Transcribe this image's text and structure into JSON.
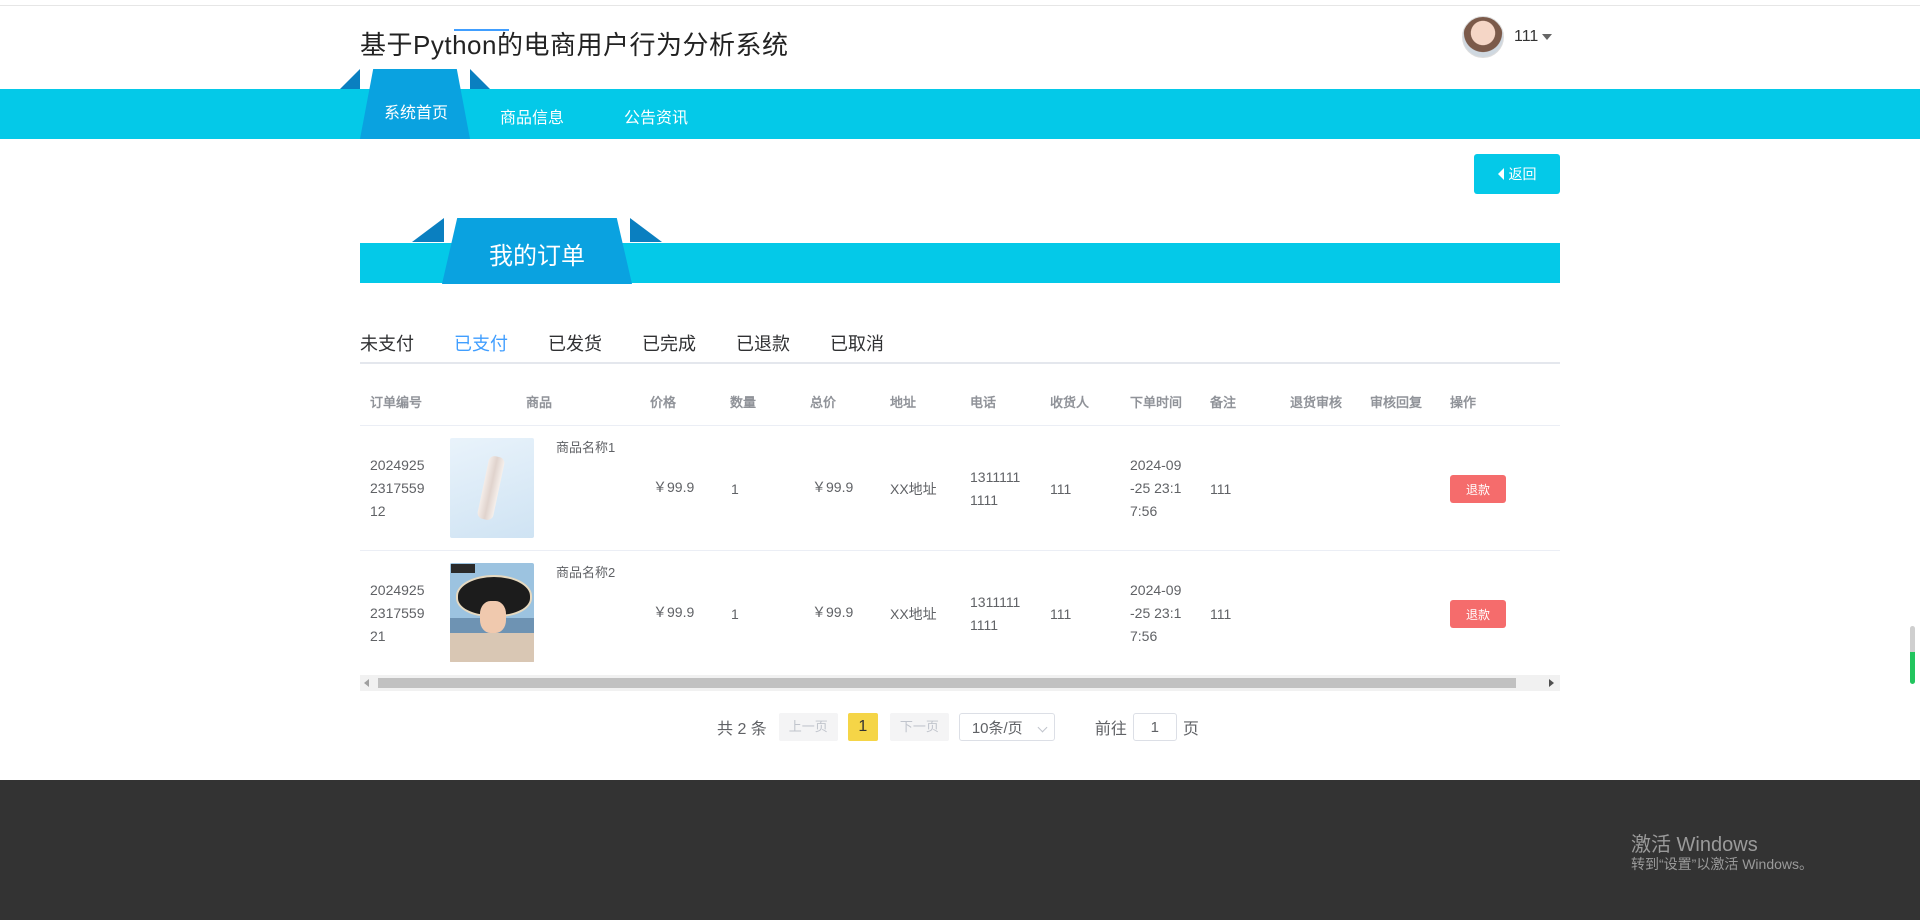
{
  "header": {
    "title": "基于Python的电商用户行为分析系统",
    "user": {
      "name": "111"
    }
  },
  "nav": {
    "items": [
      {
        "label": "系统首页",
        "active": true
      },
      {
        "label": "商品信息",
        "active": false
      },
      {
        "label": "公告资讯",
        "active": false
      }
    ]
  },
  "page": {
    "back_label": "返回",
    "section_title": "我的订单"
  },
  "order_tabs": {
    "items": [
      "未支付",
      "已支付",
      "已发货",
      "已完成",
      "已退款",
      "已取消"
    ],
    "active": "已支付"
  },
  "table": {
    "columns": [
      "订单编号",
      "商品",
      "价格",
      "数量",
      "总价",
      "地址",
      "电话",
      "收货人",
      "下单时间",
      "备注",
      "退货审核",
      "审核回复",
      "操作"
    ],
    "rows": [
      {
        "order_no": [
          "2024925",
          "2317559",
          "12"
        ],
        "product_name": "商品名称1",
        "price": "￥99.9",
        "qty": "1",
        "total": "￥99.9",
        "address": "XX地址",
        "phone": [
          "1311111",
          "1111"
        ],
        "receiver": "111",
        "time": [
          "2024-09",
          "-25 23:1",
          "7:56"
        ],
        "remark": "111",
        "action": "退款"
      },
      {
        "order_no": [
          "2024925",
          "2317559",
          "21"
        ],
        "product_name": "商品名称2",
        "price": "￥99.9",
        "qty": "1",
        "total": "￥99.9",
        "address": "XX地址",
        "phone": [
          "1311111",
          "1111"
        ],
        "receiver": "111",
        "time": [
          "2024-09",
          "-25 23:1",
          "7:56"
        ],
        "remark": "111",
        "action": "退款"
      }
    ]
  },
  "pagination": {
    "total_text": "共 2 条",
    "prev": "上一页",
    "current": "1",
    "next": "下一页",
    "page_size": "10条/页",
    "goto_prefix": "前往",
    "goto_value": "1",
    "goto_suffix": "页"
  },
  "watermark": {
    "line1": "激活 Windows",
    "line2": "转到“设置”以激活 Windows。"
  },
  "colors": {
    "nav": "#04c9e8",
    "nav_active": "#0aa2e0",
    "tab_active": "#409eff",
    "danger": "#f56c6c",
    "page_current": "#f5d547",
    "footer": "#333333"
  }
}
